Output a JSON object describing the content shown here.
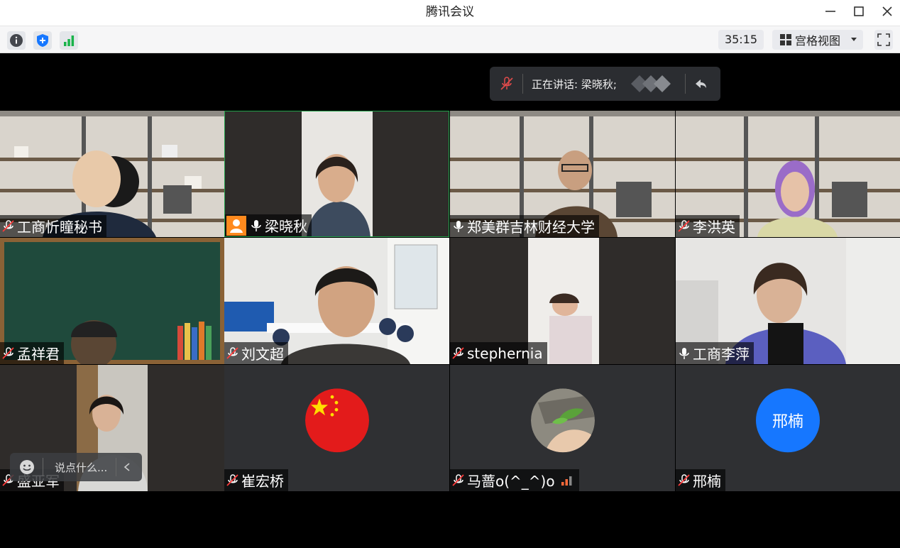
{
  "window": {
    "title": "腾讯会议"
  },
  "toolbar": {
    "info_icon": "info-icon",
    "security_icon": "shield-icon",
    "signal_icon": "signal-icon",
    "timer": "35:15",
    "view_label": "宫格视图",
    "fullscreen_icon": "fullscreen-icon"
  },
  "speaking": {
    "label": "正在讲话: 梁晓秋;"
  },
  "tiles": [
    {
      "name": "工商忻瞳秘书",
      "mic": "muted"
    },
    {
      "name": "梁晓秋",
      "mic": "on",
      "host": true
    },
    {
      "name": "郑美群吉林财经大学",
      "mic": "on"
    },
    {
      "name": "李洪英",
      "mic": "muted"
    },
    {
      "name": "孟祥君",
      "mic": "muted"
    },
    {
      "name": "刘文超",
      "mic": "muted"
    },
    {
      "name": "stephernia",
      "mic": "muted"
    },
    {
      "name": "工商李萍",
      "mic": "on"
    },
    {
      "name": "盛亚军",
      "mic": "muted"
    },
    {
      "name": "崔宏桥",
      "mic": "muted"
    },
    {
      "name": "马蔷o(^_^)o",
      "mic": "muted"
    },
    {
      "name": "邢楠",
      "mic": "muted",
      "avatar_text": "邢楠"
    }
  ],
  "chat": {
    "placeholder": "说点什么..."
  },
  "colors": {
    "accent": "#1677ff",
    "host_badge": "#ff8a1e",
    "flag_red": "#e31b1b",
    "flag_star": "#ffde00"
  }
}
